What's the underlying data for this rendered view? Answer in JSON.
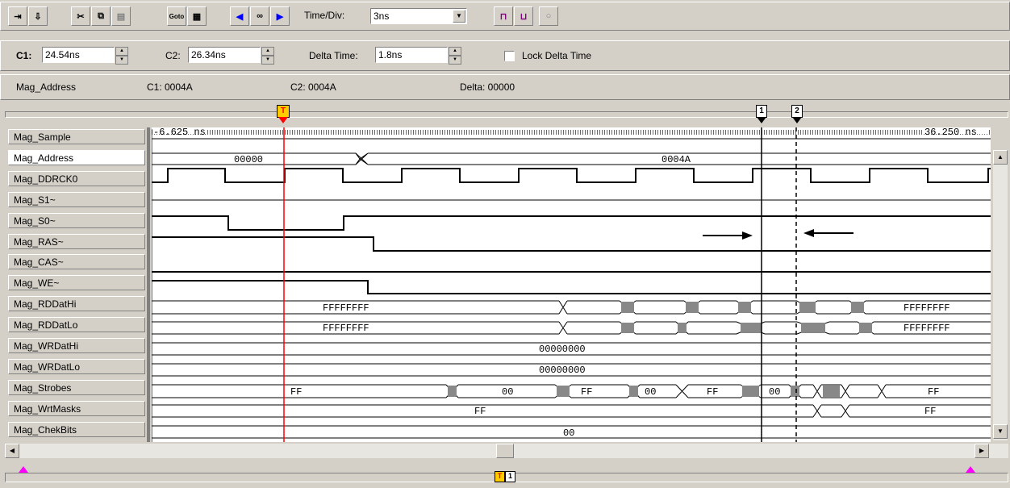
{
  "toolbar": {
    "buttons": [
      "insert-signal-icon",
      "add-signal-icon",
      "cut-icon",
      "copy-icon",
      "paste-icon",
      "goto-icon",
      "properties-icon",
      "search-left-icon",
      "binoculars-icon",
      "search-right-icon",
      "zoom-pulse-icon",
      "zoom-fit-icon",
      "magnifier-icon"
    ],
    "goto_label": "Goto",
    "timediv_label": "Time/Div:",
    "timediv_value": "3ns"
  },
  "cursor_bar": {
    "c1_label": "C1:",
    "c1_value": "24.54ns",
    "c2_label": "C2:",
    "c2_value": "26.34ns",
    "delta_label": "Delta Time:",
    "delta_value": "1.8ns",
    "lock_label": "Lock Delta Time"
  },
  "info_bar": {
    "signal": "Mag_Address",
    "c1": "C1: 0004A",
    "c2": "C2: 0004A",
    "delta": "Delta: 00000"
  },
  "markers": {
    "trigger": "T",
    "cursor1": "1",
    "cursor2": "2"
  },
  "timeline": {
    "start": "-6.625 ns",
    "end": "36.250 ns"
  },
  "signals": [
    {
      "name": "Mag_Sample"
    },
    {
      "name": "Mag_Address"
    },
    {
      "name": "Mag_DDRCK0"
    },
    {
      "name": "Mag_S1~"
    },
    {
      "name": "Mag_S0~"
    },
    {
      "name": "Mag_RAS~"
    },
    {
      "name": "Mag_CAS~"
    },
    {
      "name": "Mag_WE~"
    },
    {
      "name": "Mag_RDDatHi"
    },
    {
      "name": "Mag_RDDatLo"
    },
    {
      "name": "Mag_WRDatHi"
    },
    {
      "name": "Mag_WRDatLo"
    },
    {
      "name": "Mag_Strobes"
    },
    {
      "name": "Mag_WrtMasks"
    },
    {
      "name": "Mag_ChekBits"
    }
  ],
  "bus_values": {
    "address_a": "00000",
    "address_b": "0004A",
    "rdhi": "FFFFFFFF",
    "rdhi_end": "FFFFFFFF",
    "rdlo": "FFFFFFFF",
    "rdlo_end": "FFFFFFFF",
    "wrhi": "00000000",
    "wrlo": "00000000",
    "strobes": [
      "FF",
      "00",
      "FF",
      "00",
      "FF",
      "00",
      "FF"
    ],
    "masks_a": "FF",
    "masks_b": "FF",
    "chek": "00"
  },
  "colors": {
    "trigger_line": "#ff0000",
    "background": "#d4d0c8",
    "wave_bg": "#ffffff"
  }
}
